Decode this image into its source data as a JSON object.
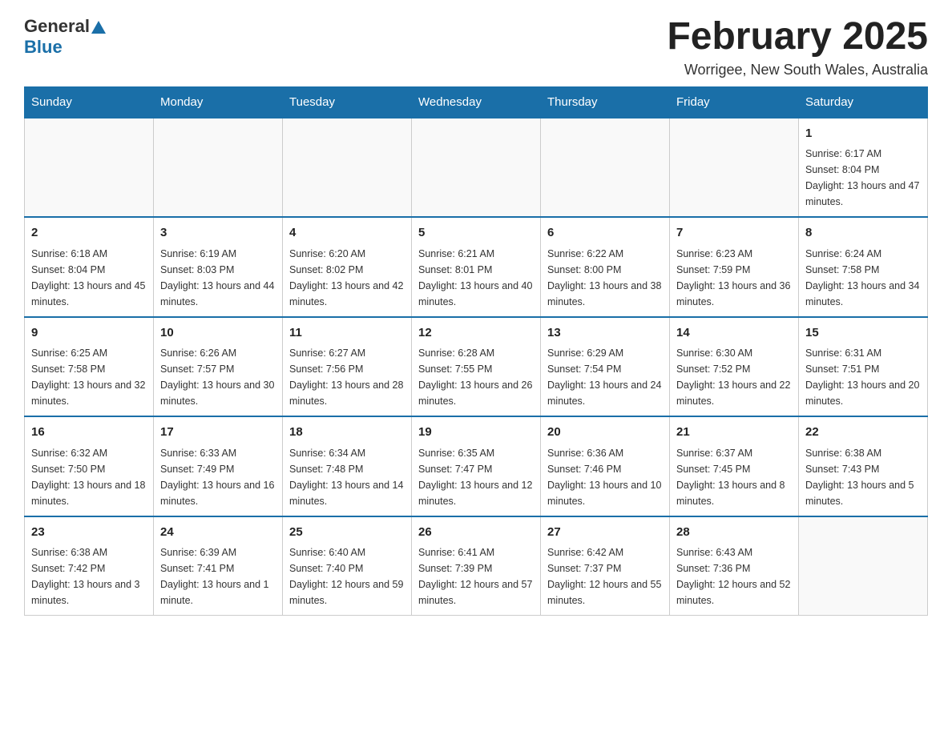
{
  "header": {
    "logo_general": "General",
    "logo_blue": "Blue",
    "month_title": "February 2025",
    "location": "Worrigee, New South Wales, Australia"
  },
  "days_of_week": [
    "Sunday",
    "Monday",
    "Tuesday",
    "Wednesday",
    "Thursday",
    "Friday",
    "Saturday"
  ],
  "weeks": [
    [
      {
        "day": "",
        "info": ""
      },
      {
        "day": "",
        "info": ""
      },
      {
        "day": "",
        "info": ""
      },
      {
        "day": "",
        "info": ""
      },
      {
        "day": "",
        "info": ""
      },
      {
        "day": "",
        "info": ""
      },
      {
        "day": "1",
        "info": "Sunrise: 6:17 AM\nSunset: 8:04 PM\nDaylight: 13 hours and 47 minutes."
      }
    ],
    [
      {
        "day": "2",
        "info": "Sunrise: 6:18 AM\nSunset: 8:04 PM\nDaylight: 13 hours and 45 minutes."
      },
      {
        "day": "3",
        "info": "Sunrise: 6:19 AM\nSunset: 8:03 PM\nDaylight: 13 hours and 44 minutes."
      },
      {
        "day": "4",
        "info": "Sunrise: 6:20 AM\nSunset: 8:02 PM\nDaylight: 13 hours and 42 minutes."
      },
      {
        "day": "5",
        "info": "Sunrise: 6:21 AM\nSunset: 8:01 PM\nDaylight: 13 hours and 40 minutes."
      },
      {
        "day": "6",
        "info": "Sunrise: 6:22 AM\nSunset: 8:00 PM\nDaylight: 13 hours and 38 minutes."
      },
      {
        "day": "7",
        "info": "Sunrise: 6:23 AM\nSunset: 7:59 PM\nDaylight: 13 hours and 36 minutes."
      },
      {
        "day": "8",
        "info": "Sunrise: 6:24 AM\nSunset: 7:58 PM\nDaylight: 13 hours and 34 minutes."
      }
    ],
    [
      {
        "day": "9",
        "info": "Sunrise: 6:25 AM\nSunset: 7:58 PM\nDaylight: 13 hours and 32 minutes."
      },
      {
        "day": "10",
        "info": "Sunrise: 6:26 AM\nSunset: 7:57 PM\nDaylight: 13 hours and 30 minutes."
      },
      {
        "day": "11",
        "info": "Sunrise: 6:27 AM\nSunset: 7:56 PM\nDaylight: 13 hours and 28 minutes."
      },
      {
        "day": "12",
        "info": "Sunrise: 6:28 AM\nSunset: 7:55 PM\nDaylight: 13 hours and 26 minutes."
      },
      {
        "day": "13",
        "info": "Sunrise: 6:29 AM\nSunset: 7:54 PM\nDaylight: 13 hours and 24 minutes."
      },
      {
        "day": "14",
        "info": "Sunrise: 6:30 AM\nSunset: 7:52 PM\nDaylight: 13 hours and 22 minutes."
      },
      {
        "day": "15",
        "info": "Sunrise: 6:31 AM\nSunset: 7:51 PM\nDaylight: 13 hours and 20 minutes."
      }
    ],
    [
      {
        "day": "16",
        "info": "Sunrise: 6:32 AM\nSunset: 7:50 PM\nDaylight: 13 hours and 18 minutes."
      },
      {
        "day": "17",
        "info": "Sunrise: 6:33 AM\nSunset: 7:49 PM\nDaylight: 13 hours and 16 minutes."
      },
      {
        "day": "18",
        "info": "Sunrise: 6:34 AM\nSunset: 7:48 PM\nDaylight: 13 hours and 14 minutes."
      },
      {
        "day": "19",
        "info": "Sunrise: 6:35 AM\nSunset: 7:47 PM\nDaylight: 13 hours and 12 minutes."
      },
      {
        "day": "20",
        "info": "Sunrise: 6:36 AM\nSunset: 7:46 PM\nDaylight: 13 hours and 10 minutes."
      },
      {
        "day": "21",
        "info": "Sunrise: 6:37 AM\nSunset: 7:45 PM\nDaylight: 13 hours and 8 minutes."
      },
      {
        "day": "22",
        "info": "Sunrise: 6:38 AM\nSunset: 7:43 PM\nDaylight: 13 hours and 5 minutes."
      }
    ],
    [
      {
        "day": "23",
        "info": "Sunrise: 6:38 AM\nSunset: 7:42 PM\nDaylight: 13 hours and 3 minutes."
      },
      {
        "day": "24",
        "info": "Sunrise: 6:39 AM\nSunset: 7:41 PM\nDaylight: 13 hours and 1 minute."
      },
      {
        "day": "25",
        "info": "Sunrise: 6:40 AM\nSunset: 7:40 PM\nDaylight: 12 hours and 59 minutes."
      },
      {
        "day": "26",
        "info": "Sunrise: 6:41 AM\nSunset: 7:39 PM\nDaylight: 12 hours and 57 minutes."
      },
      {
        "day": "27",
        "info": "Sunrise: 6:42 AM\nSunset: 7:37 PM\nDaylight: 12 hours and 55 minutes."
      },
      {
        "day": "28",
        "info": "Sunrise: 6:43 AM\nSunset: 7:36 PM\nDaylight: 12 hours and 52 minutes."
      },
      {
        "day": "",
        "info": ""
      }
    ]
  ]
}
